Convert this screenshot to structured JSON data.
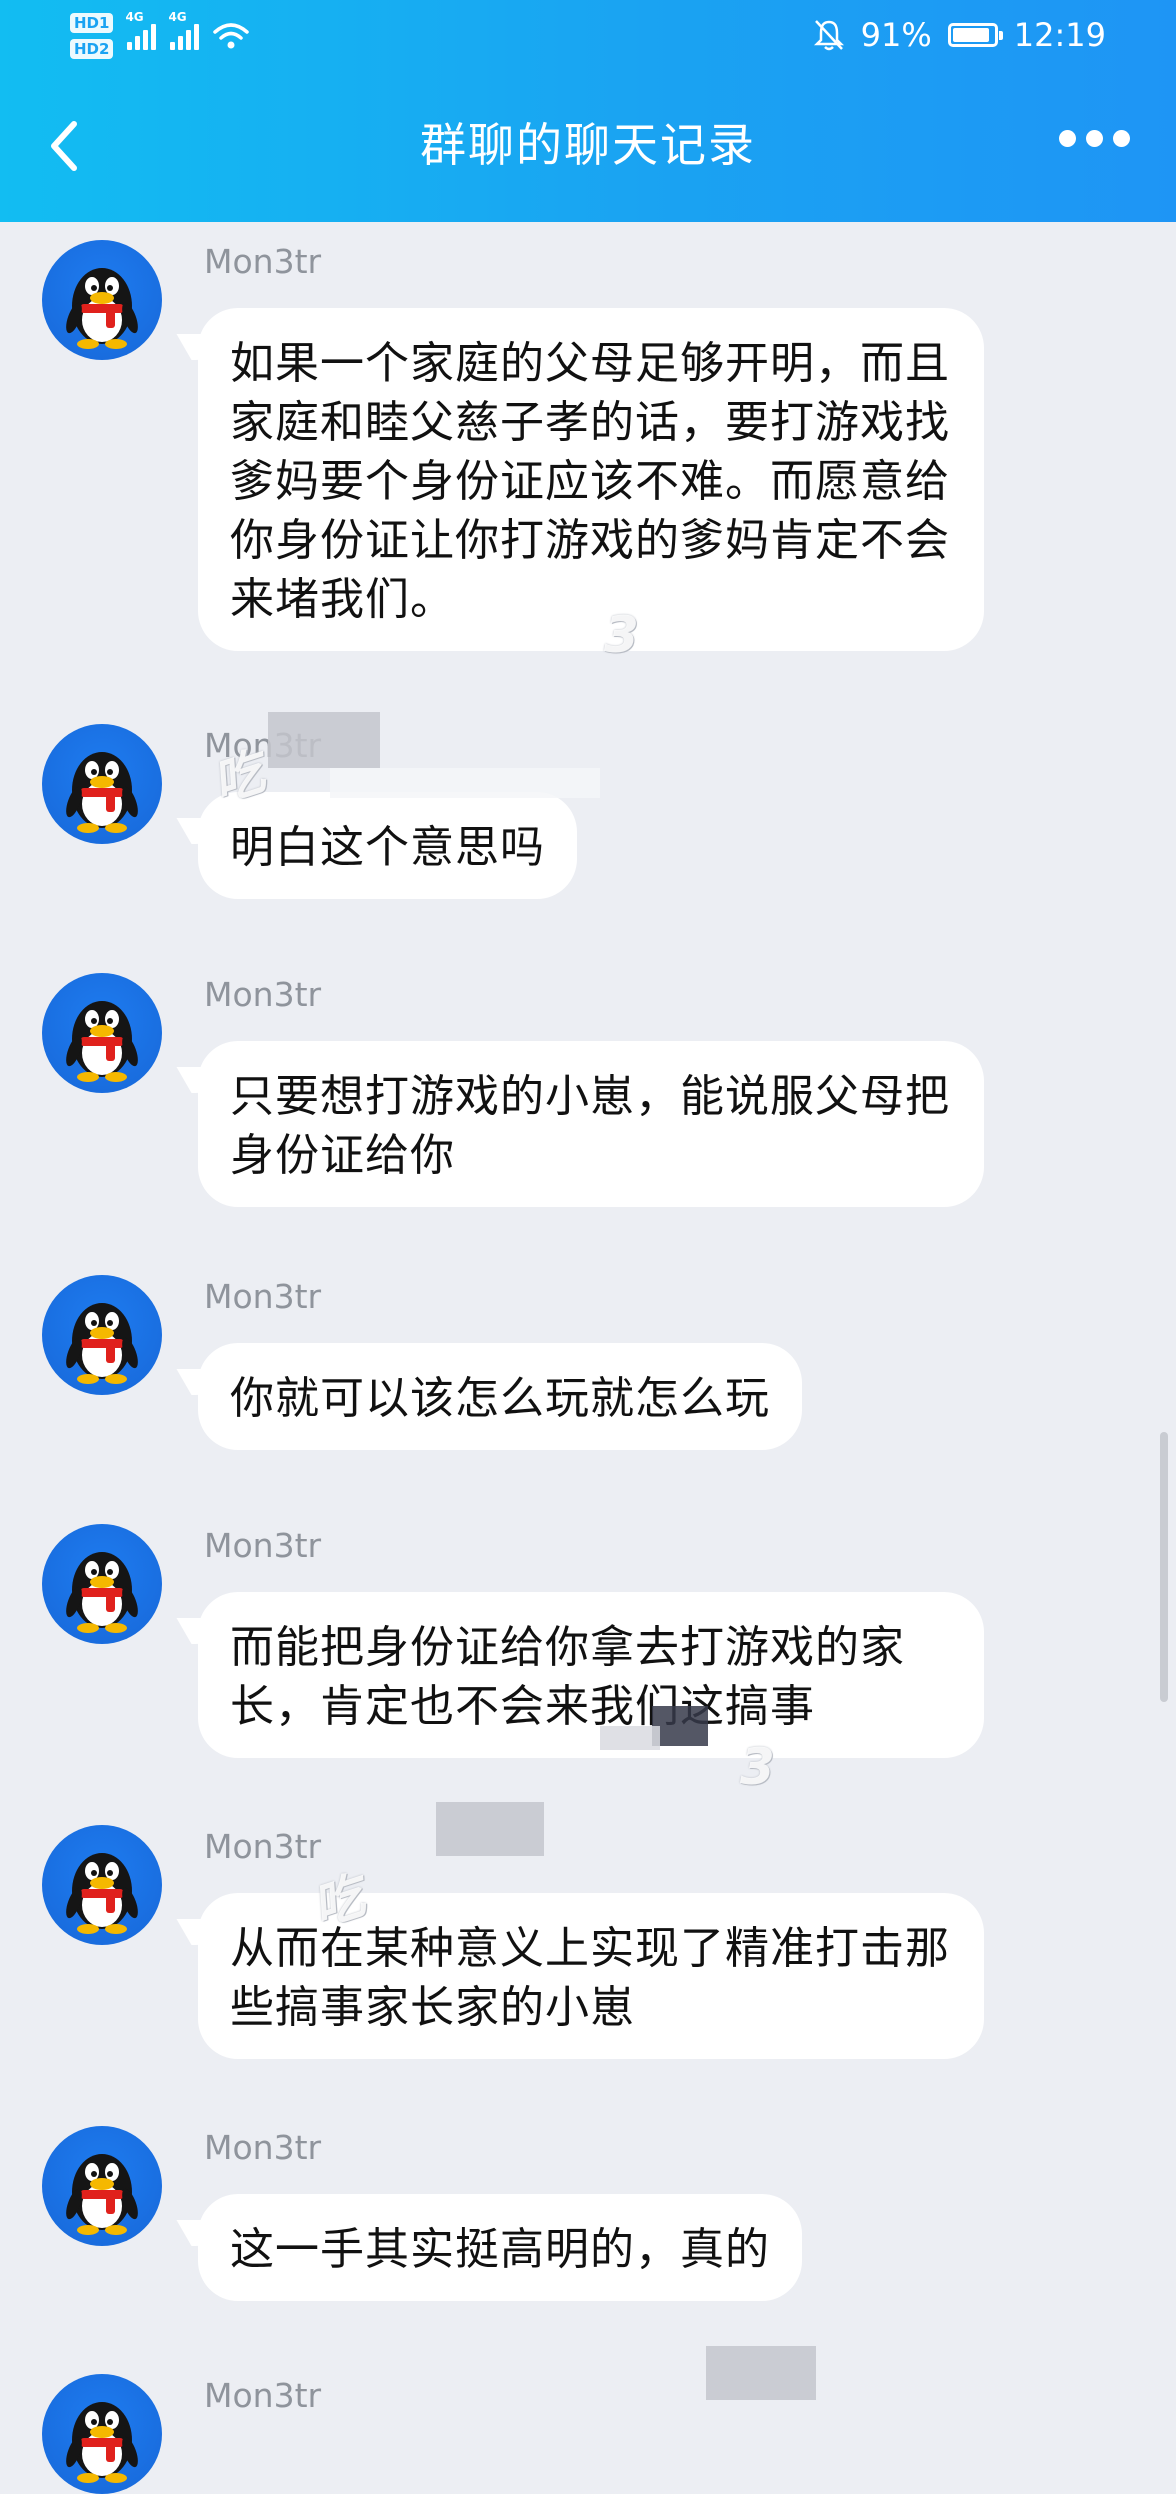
{
  "status_bar": {
    "hd_badges": [
      "HD1",
      "HD2"
    ],
    "network_1": "4G",
    "network_2": "4G",
    "battery_percent": "91%",
    "battery_level": 0.91,
    "time": "12:19"
  },
  "header": {
    "title": "群聊的聊天记录",
    "back_icon": "chevron-left-icon",
    "more_icon": "more-dots-icon"
  },
  "messages": [
    {
      "sender": "Mon3tr",
      "text": "如果一个家庭的父母足够开明，而且家庭和睦父慈子孝的话，要打游戏找爹妈要个身份证应该不难。而愿意给你身份证让你打游戏的爹妈肯定不会来堵我们。"
    },
    {
      "sender": "Mon3tr",
      "text": "明白这个意思吗"
    },
    {
      "sender": "Mon3tr",
      "text": "只要想打游戏的小崽，能说服父母把身份证给你"
    },
    {
      "sender": "Mon3tr",
      "text": "你就可以该怎么玩就怎么玩"
    },
    {
      "sender": "Mon3tr",
      "text": "而能把身份证给你拿去打游戏的家长，肯定也不会来我们这搞事"
    },
    {
      "sender": "Mon3tr",
      "text": "从而在某种意义上实现了精准打击那些搞事家长家的小崽"
    },
    {
      "sender": "Mon3tr",
      "text": "这一手其实挺高明的，真的"
    },
    {
      "sender": "Mon3tr",
      "text": ""
    }
  ],
  "colors": {
    "header_start": "#12bdf2",
    "header_end": "#1e95f5",
    "chat_background": "#eceef3",
    "bubble": "#ffffff",
    "sender_name": "#8f949c"
  },
  "watermarks": [
    "3",
    "吃",
    "3",
    "吃"
  ]
}
